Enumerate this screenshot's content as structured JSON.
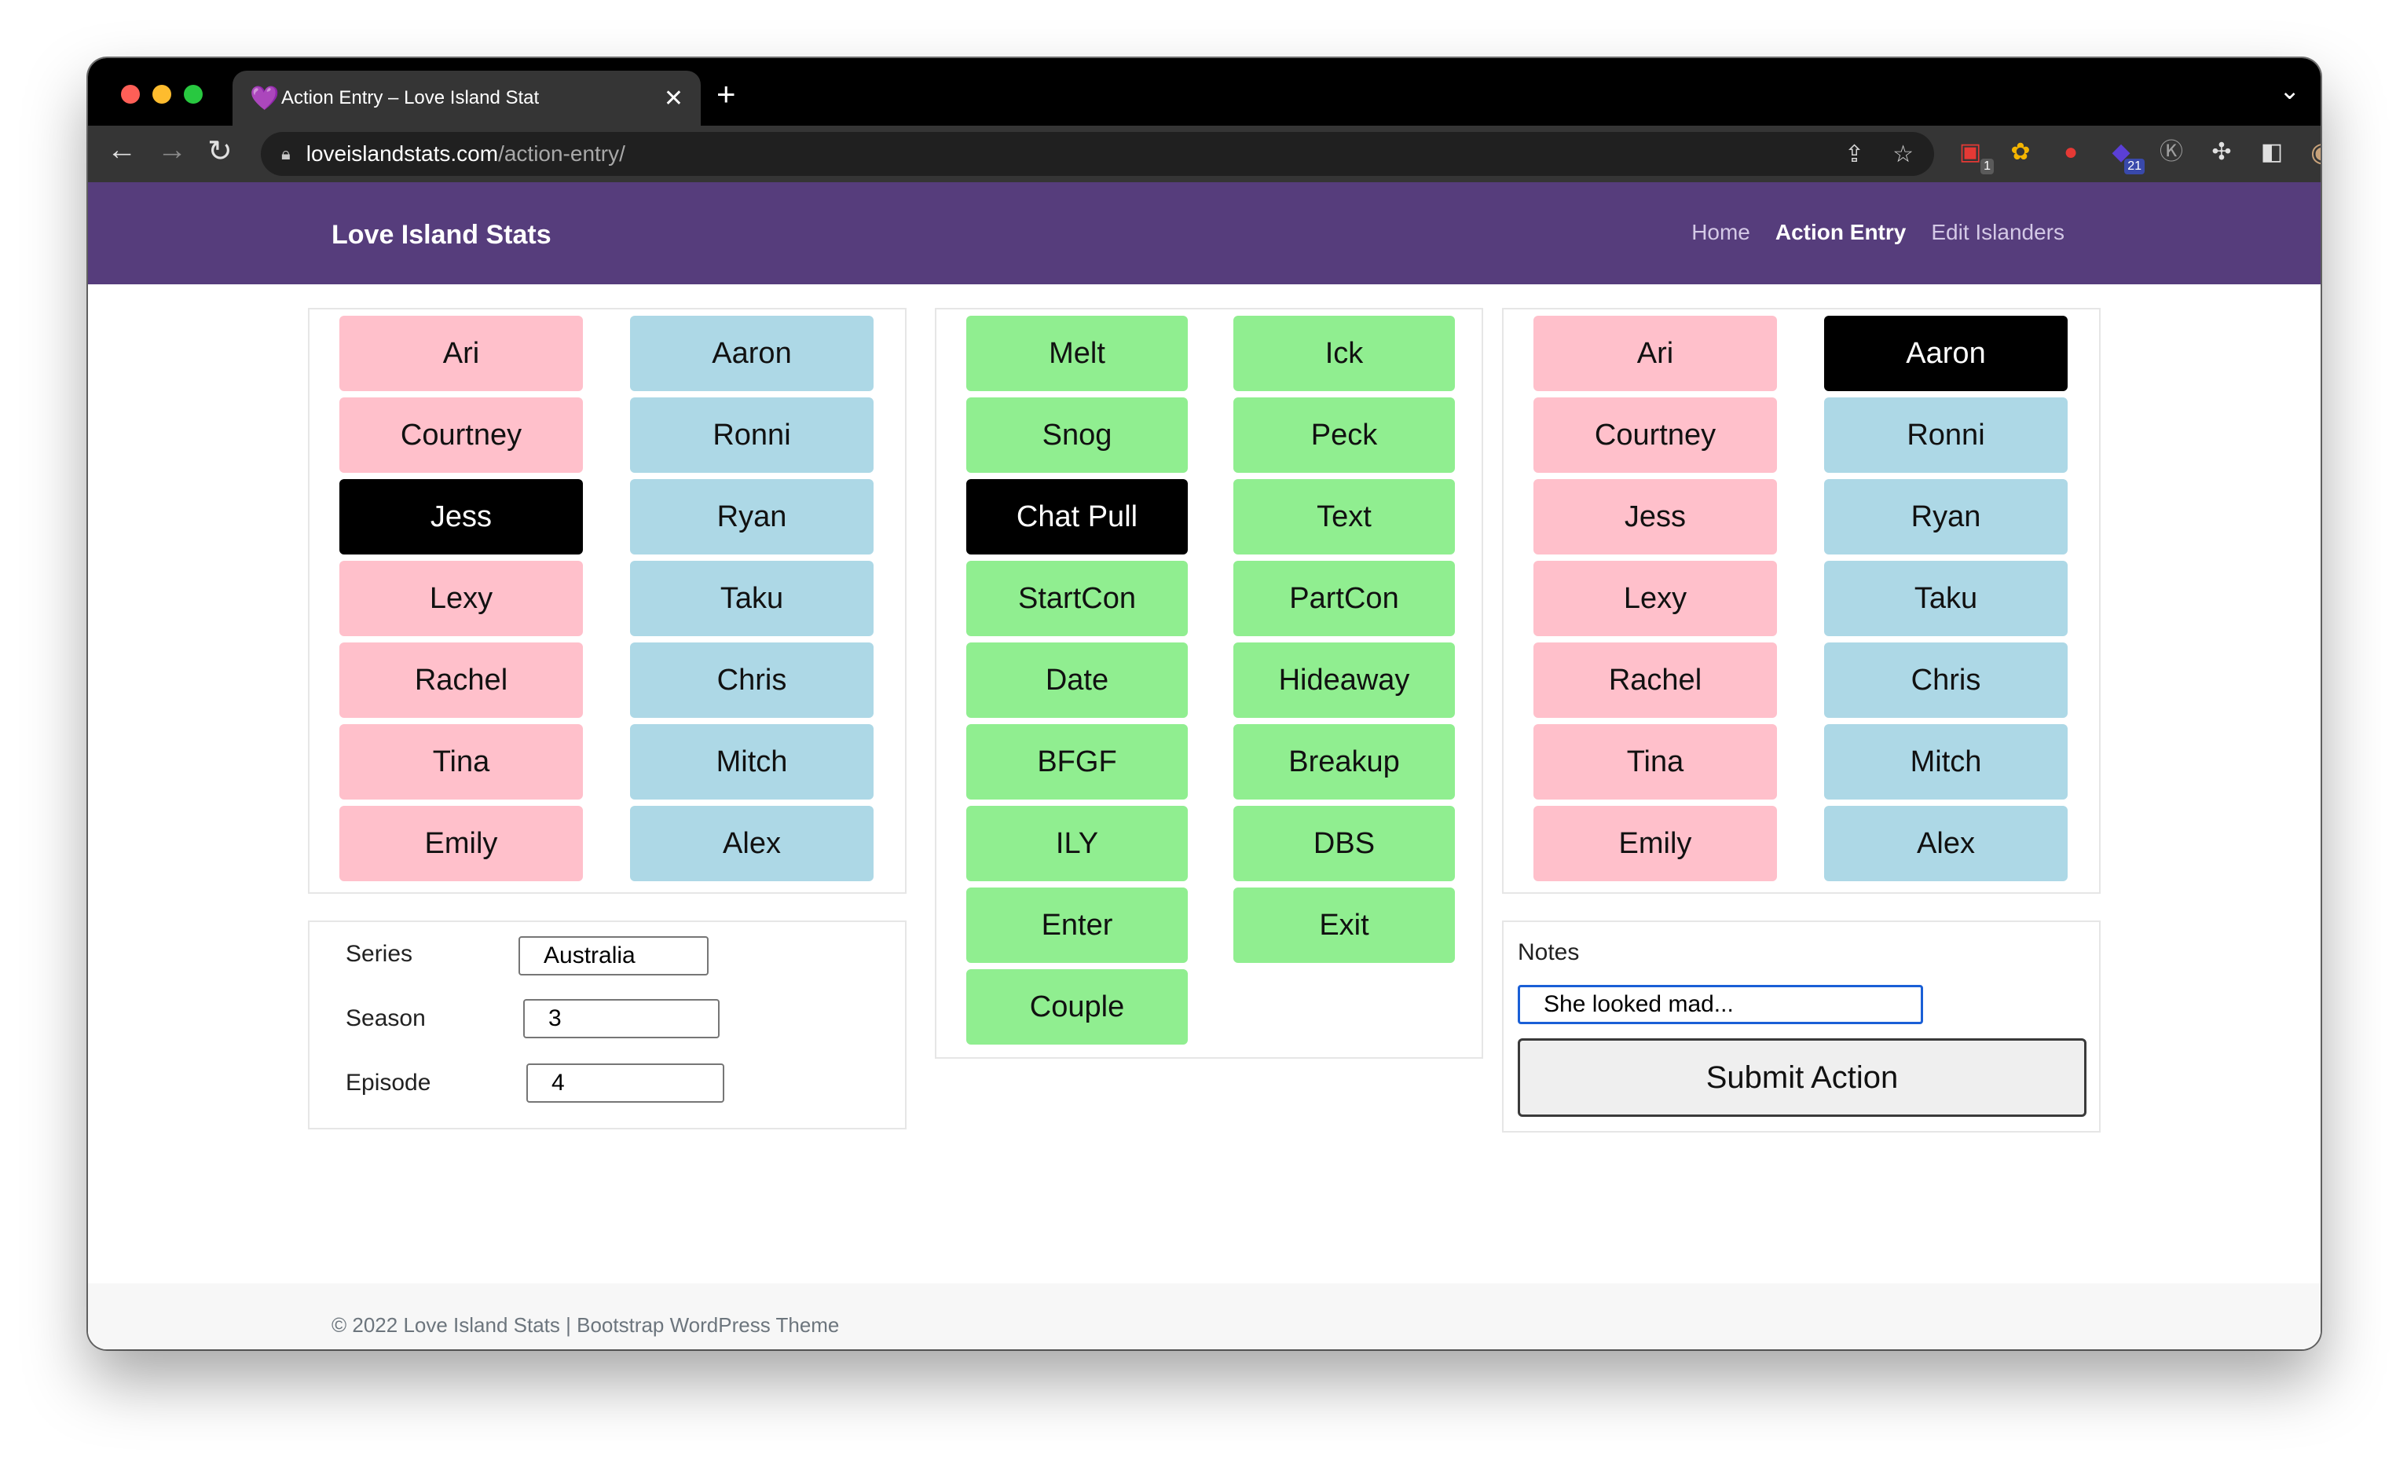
{
  "browser": {
    "tab_title": "Action Entry – Love Island Stat",
    "tab_favicon": "💜",
    "url_host": "loveislandstats.com",
    "url_path": "/action-entry/",
    "extension_badges": [
      "1",
      "21"
    ]
  },
  "site": {
    "brand": "Love Island Stats",
    "nav": [
      "Home",
      "Action Entry",
      "Edit Islanders"
    ],
    "active_nav": "Action Entry"
  },
  "islanders_left": {
    "girls": [
      "Ari",
      "Courtney",
      "Jess",
      "Lexy",
      "Rachel",
      "Tina",
      "Emily"
    ],
    "boys": [
      "Aaron",
      "Ronni",
      "Ryan",
      "Taku",
      "Chris",
      "Mitch",
      "Alex"
    ],
    "selected": "Jess"
  },
  "actions": {
    "left": [
      "Melt",
      "Snog",
      "Chat Pull",
      "StartCon",
      "Date",
      "BFGF",
      "ILY",
      "Enter",
      "Couple"
    ],
    "right": [
      "Ick",
      "Peck",
      "Text",
      "PartCon",
      "Hideaway",
      "Breakup",
      "DBS",
      "Exit"
    ],
    "selected": "Chat Pull"
  },
  "islanders_right": {
    "girls": [
      "Ari",
      "Courtney",
      "Jess",
      "Lexy",
      "Rachel",
      "Tina",
      "Emily"
    ],
    "boys": [
      "Aaron",
      "Ronni",
      "Ryan",
      "Taku",
      "Chris",
      "Mitch",
      "Alex"
    ],
    "selected": "Aaron"
  },
  "episode_form": {
    "series_label": "Series",
    "series_value": "Australia",
    "season_label": "Season",
    "season_value": "3",
    "episode_label": "Episode",
    "episode_value": "4"
  },
  "notes_form": {
    "label": "Notes",
    "value": "She looked mad...",
    "submit_label": "Submit Action"
  },
  "footer": {
    "text": "© 2022 Love Island Stats | Bootstrap WordPress Theme"
  },
  "colors": {
    "navbar": "#563d7c",
    "girl": "#ffc0cb",
    "boy": "#add8e6",
    "action": "#90ee90",
    "selected": "#000000"
  }
}
